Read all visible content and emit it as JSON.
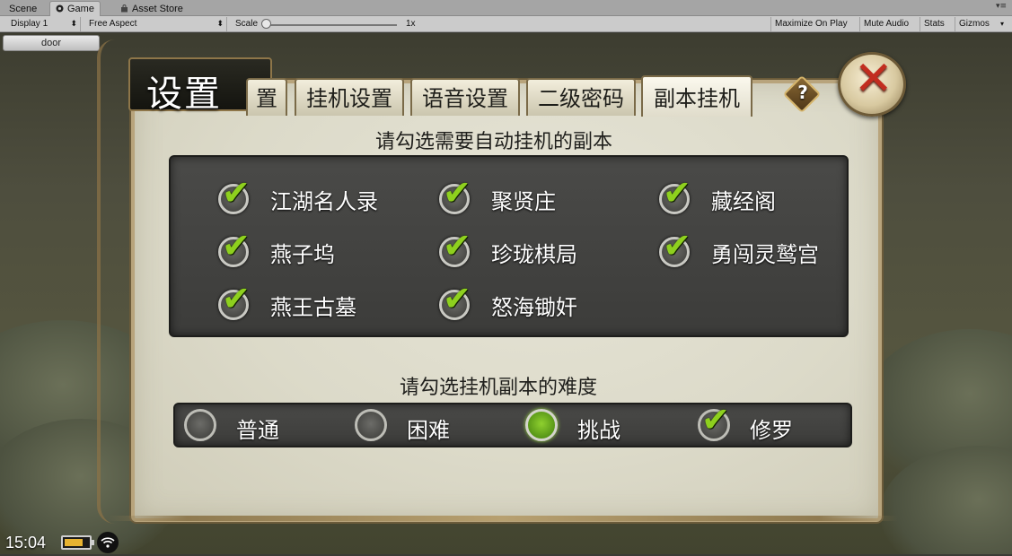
{
  "editor": {
    "tabs": [
      {
        "label": "Scene"
      },
      {
        "label": "Game"
      },
      {
        "label": "Asset Store"
      }
    ],
    "toolbar": {
      "display": "Display 1",
      "aspect": "Free Aspect",
      "scale_label": "Scale",
      "scale_value": "1x",
      "maximize_on_play": "Maximize On Play",
      "mute_audio": "Mute Audio",
      "stats": "Stats",
      "gizmos": "Gizmos"
    }
  },
  "game": {
    "door_button": "door",
    "panel": {
      "title": "设置",
      "tabs": [
        {
          "label": "置",
          "active": false
        },
        {
          "label": "挂机设置",
          "active": false
        },
        {
          "label": "语音设置",
          "active": false
        },
        {
          "label": "二级密码",
          "active": false
        },
        {
          "label": "副本挂机",
          "active": true
        }
      ],
      "help_symbol": "?",
      "close_symbol": "✕",
      "dungeon_heading": "请勾选需要自动挂机的副本",
      "dungeons": [
        {
          "label": "江湖名人录",
          "checked": true
        },
        {
          "label": "聚贤庄",
          "checked": true
        },
        {
          "label": "藏经阁",
          "checked": true
        },
        {
          "label": "燕子坞",
          "checked": true
        },
        {
          "label": "珍珑棋局",
          "checked": true
        },
        {
          "label": "勇闯灵鹫宫",
          "checked": true
        },
        {
          "label": "燕王古墓",
          "checked": true
        },
        {
          "label": "怒海锄奸",
          "checked": true
        }
      ],
      "difficulty_heading": "请勾选挂机副本的难度",
      "difficulties": [
        {
          "label": "普通",
          "state": "off"
        },
        {
          "label": "困难",
          "state": "off"
        },
        {
          "label": "挑战",
          "state": "selected"
        },
        {
          "label": "修罗",
          "state": "checked"
        }
      ]
    },
    "hud": {
      "time": "15:04"
    }
  },
  "colors": {
    "check_green": "#8ed01e",
    "close_red": "#c22d1f",
    "panel_bg": "#dcdac9"
  }
}
